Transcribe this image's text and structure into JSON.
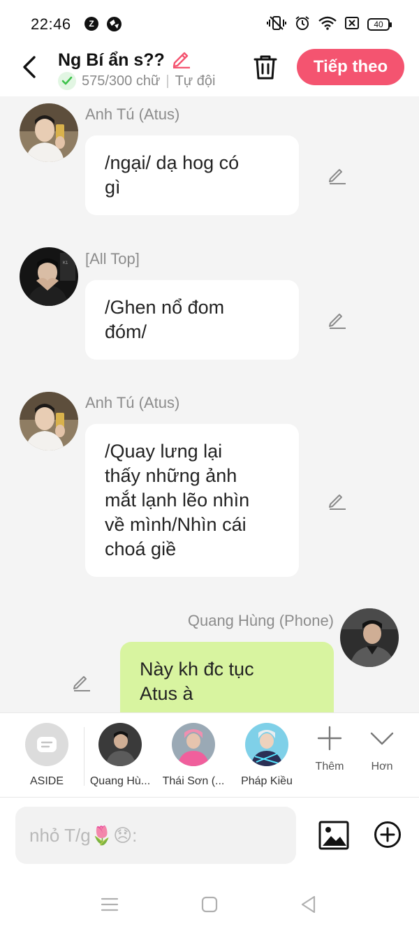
{
  "status_bar": {
    "time": "22:46",
    "app_icon_1": "Z",
    "battery": "40"
  },
  "header": {
    "title": "Ng Bí ẩn s??",
    "subtitle_count": "575/300 chữ",
    "subtitle_separator": "|",
    "subtitle_mode": "Tự đội",
    "next_button": "Tiếp theo"
  },
  "messages": [
    {
      "sender": "Anh Tú (Atus)",
      "lines": [
        "/ngại/ dạ hog có",
        "gì"
      ]
    },
    {
      "sender": "[All Top]",
      "lines": [
        "/Ghen nổ đom",
        "đóm/"
      ]
    },
    {
      "sender": "Anh Tú (Atus)",
      "lines": [
        "/Quay lưng lại",
        "thấy những ảnh",
        "mắt lạnh lẽo nhìn",
        "về mình/Nhìn cái",
        "choá giề"
      ]
    },
    {
      "sender": "Quang Hùng (Phone)",
      "lines": [
        "Này kh đc tục",
        "Atus à"
      ]
    }
  ],
  "characters": [
    {
      "label": "ASIDE"
    },
    {
      "label": "Quang Hù..."
    },
    {
      "label": "Thái Sơn (..."
    },
    {
      "label": "Pháp Kiều"
    }
  ],
  "tools": {
    "more_label": "Thêm",
    "expand_label": "Hơn"
  },
  "input": {
    "placeholder": "nhỏ T/g🌷😞:"
  },
  "colors": {
    "accent": "#f45470",
    "my_bubble": "#d8f4a0",
    "chat_bg": "#f4f4f4",
    "verified": "#3cc24a"
  }
}
